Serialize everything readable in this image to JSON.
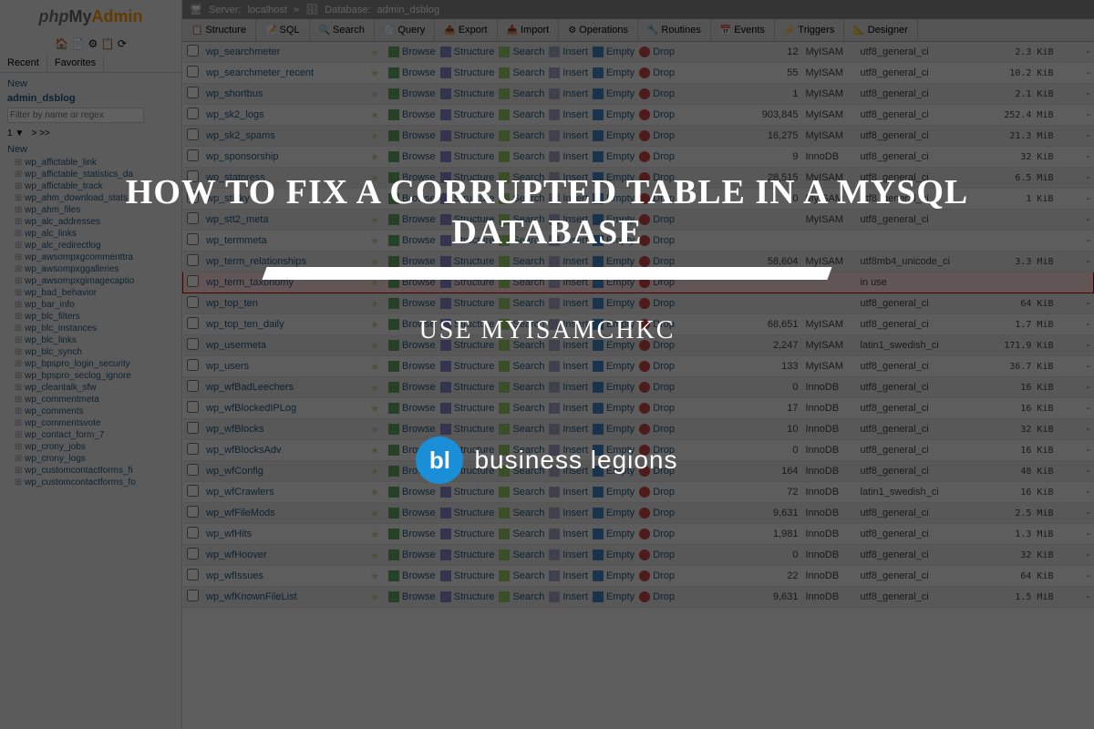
{
  "logo": {
    "php": "php",
    "my": "My",
    "admin": "Admin"
  },
  "sidebar": {
    "tabs": {
      "recent": "Recent",
      "favorites": "Favorites"
    },
    "new": "New",
    "database": "admin_dsblog",
    "filter_placeholder": "Filter by name or regex",
    "pager": {
      "page": "1",
      "nav": "> >>"
    },
    "new2": "New",
    "items": [
      "wp_affictable_link",
      "wp_affictable_statistics_da",
      "wp_affictable_track",
      "wp_ahm_download_stats",
      "wp_ahm_files",
      "wp_alc_addresses",
      "wp_alc_links",
      "wp_alc_redirectlog",
      "wp_awsompxgcommenttra",
      "wp_awsompxggalleries",
      "wp_awsompxgimagecaptio",
      "wp_bad_behavior",
      "wp_bar_info",
      "wp_blc_filters",
      "wp_blc_instances",
      "wp_blc_links",
      "wp_blc_synch",
      "wp_bpspro_login_security",
      "wp_bpspro_seclog_ignore",
      "wp_cleantalk_sfw",
      "wp_commentmeta",
      "wp_comments",
      "wp_commentsvote",
      "wp_contact_form_7",
      "wp_crony_jobs",
      "wp_crony_logs",
      "wp_customcontactforms_fi",
      "wp_customcontactforms_fo"
    ]
  },
  "breadcrumb": {
    "server_label": "Server:",
    "server": "localhost",
    "db_label": "Database:",
    "db": "admin_dsblog"
  },
  "tabs": [
    {
      "icon": "📋",
      "label": "Structure"
    },
    {
      "icon": "📝",
      "label": "SQL"
    },
    {
      "icon": "🔍",
      "label": "Search"
    },
    {
      "icon": "📄",
      "label": "Query"
    },
    {
      "icon": "📤",
      "label": "Export"
    },
    {
      "icon": "📥",
      "label": "Import"
    },
    {
      "icon": "⚙",
      "label": "Operations"
    },
    {
      "icon": "🔧",
      "label": "Routines"
    },
    {
      "icon": "📅",
      "label": "Events"
    },
    {
      "icon": "⚡",
      "label": "Triggers"
    },
    {
      "icon": "📐",
      "label": "Designer"
    }
  ],
  "actions": {
    "browse": "Browse",
    "structure": "Structure",
    "search": "Search",
    "insert": "Insert",
    "empty": "Empty",
    "drop": "Drop"
  },
  "tables": [
    {
      "name": "wp_searchmeter",
      "rows": "12",
      "engine": "MyISAM",
      "collation": "utf8_general_ci",
      "size": "2.3 KiB",
      "overhead": "-"
    },
    {
      "name": "wp_searchmeter_recent",
      "rows": "55",
      "engine": "MyISAM",
      "collation": "utf8_general_ci",
      "size": "10.2 KiB",
      "overhead": "-"
    },
    {
      "name": "wp_shortbus",
      "rows": "1",
      "engine": "MyISAM",
      "collation": "utf8_general_ci",
      "size": "2.1 KiB",
      "overhead": "-"
    },
    {
      "name": "wp_sk2_logs",
      "rows": "903,845",
      "engine": "MyISAM",
      "collation": "utf8_general_ci",
      "size": "252.4 MiB",
      "overhead": "-"
    },
    {
      "name": "wp_sk2_spams",
      "rows": "16,275",
      "engine": "MyISAM",
      "collation": "utf8_general_ci",
      "size": "21.3 MiB",
      "overhead": "-"
    },
    {
      "name": "wp_sponsorship",
      "rows": "9",
      "engine": "InnoDB",
      "collation": "utf8_general_ci",
      "size": "32 KiB",
      "overhead": "-"
    },
    {
      "name": "wp_statpress",
      "rows": "28,515",
      "engine": "MyISAM",
      "collation": "utf8_general_ci",
      "size": "6.5 MiB",
      "overhead": "-"
    },
    {
      "name": "wp_sticky",
      "rows": "0",
      "engine": "MyISAM",
      "collation": "utf8_general_ci",
      "size": "1 KiB",
      "overhead": "-"
    },
    {
      "name": "wp_stt2_meta",
      "rows": "",
      "engine": "MyISAM",
      "collation": "utf8_general_ci",
      "size": "",
      "overhead": "-"
    },
    {
      "name": "wp_termmeta",
      "rows": "",
      "engine": "",
      "collation": "",
      "size": "",
      "overhead": "-"
    },
    {
      "name": "wp_term_relationships",
      "rows": "58,604",
      "engine": "MyISAM",
      "collation": "utf8mb4_unicode_ci",
      "size": "3.3 MiB",
      "overhead": "-"
    },
    {
      "name": "wp_term_taxonomy",
      "rows": "",
      "engine": "",
      "collation": "in use",
      "size": "",
      "overhead": "",
      "highlighted": true
    },
    {
      "name": "wp_top_ten",
      "rows": "",
      "engine": "",
      "collation": "utf8_general_ci",
      "size": "64 KiB",
      "overhead": "-"
    },
    {
      "name": "wp_top_ten_daily",
      "rows": "68,651",
      "engine": "MyISAM",
      "collation": "utf8_general_ci",
      "size": "1.7 MiB",
      "overhead": "-"
    },
    {
      "name": "wp_usermeta",
      "rows": "2,247",
      "engine": "MyISAM",
      "collation": "latin1_swedish_ci",
      "size": "171.9 KiB",
      "overhead": "-"
    },
    {
      "name": "wp_users",
      "rows": "133",
      "engine": "MyISAM",
      "collation": "utf8_general_ci",
      "size": "36.7 KiB",
      "overhead": "-"
    },
    {
      "name": "wp_wfBadLeechers",
      "rows": "0",
      "engine": "InnoDB",
      "collation": "utf8_general_ci",
      "size": "16 KiB",
      "overhead": "-"
    },
    {
      "name": "wp_wfBlockedIPLog",
      "rows": "17",
      "engine": "InnoDB",
      "collation": "utf8_general_ci",
      "size": "16 KiB",
      "overhead": "-"
    },
    {
      "name": "wp_wfBlocks",
      "rows": "10",
      "engine": "InnoDB",
      "collation": "utf8_general_ci",
      "size": "32 KiB",
      "overhead": "-"
    },
    {
      "name": "wp_wfBlocksAdv",
      "rows": "0",
      "engine": "InnoDB",
      "collation": "utf8_general_ci",
      "size": "16 KiB",
      "overhead": "-"
    },
    {
      "name": "wp_wfConfig",
      "rows": "164",
      "engine": "InnoDB",
      "collation": "utf8_general_ci",
      "size": "48 KiB",
      "overhead": "-"
    },
    {
      "name": "wp_wfCrawlers",
      "rows": "72",
      "engine": "InnoDB",
      "collation": "latin1_swedish_ci",
      "size": "16 KiB",
      "overhead": "-"
    },
    {
      "name": "wp_wfFileMods",
      "rows": "9,631",
      "engine": "InnoDB",
      "collation": "utf8_general_ci",
      "size": "2.5 MiB",
      "overhead": "-"
    },
    {
      "name": "wp_wfHits",
      "rows": "1,981",
      "engine": "InnoDB",
      "collation": "utf8_general_ci",
      "size": "1.3 MiB",
      "overhead": "-"
    },
    {
      "name": "wp_wfHoover",
      "rows": "0",
      "engine": "InnoDB",
      "collation": "utf8_general_ci",
      "size": "32 KiB",
      "overhead": "-"
    },
    {
      "name": "wp_wfIssues",
      "rows": "22",
      "engine": "InnoDB",
      "collation": "utf8_general_ci",
      "size": "64 KiB",
      "overhead": "-"
    },
    {
      "name": "wp_wfKnownFileList",
      "rows": "9,631",
      "engine": "InnoDB",
      "collation": "utf8_general_ci",
      "size": "1.5 MiB",
      "overhead": "-"
    }
  ],
  "overlay": {
    "title": "HOW TO FIX A CORRUPTED TABLE IN A MYSQL DATABASE",
    "sub": "USE MYISAMCHKC",
    "brand_icon": "bl",
    "brand_text": "business legions"
  }
}
